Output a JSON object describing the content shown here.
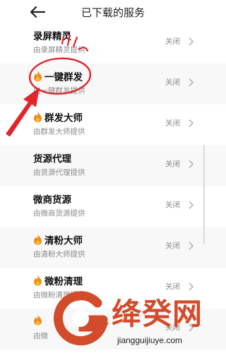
{
  "header": {
    "title": "已下载的服务"
  },
  "services": [
    {
      "name": "录屏精灵",
      "provider": "由录屏精灵提供",
      "status": "关闭",
      "fire": false
    },
    {
      "name": "一键群发",
      "provider": "由一键群发提供",
      "status": "关闭",
      "fire": true
    },
    {
      "name": "群发大师",
      "provider": "由群发大师提供",
      "status": "关闭",
      "fire": true
    },
    {
      "name": "货源代理",
      "provider": "由货源代理提供",
      "status": "关闭",
      "fire": false
    },
    {
      "name": "微商货源",
      "provider": "由微商货源提供",
      "status": "关闭",
      "fire": false
    },
    {
      "name": "清粉大师",
      "provider": "由清粉大师提供",
      "status": "关闭",
      "fire": true
    },
    {
      "name": "微粉清理",
      "provider": "由微粉清理提供",
      "status": "关闭",
      "fire": true
    },
    {
      "name": "",
      "provider": "由微",
      "status": "关闭",
      "fire": true
    }
  ],
  "watermark": {
    "brand": "绛癸网",
    "url": "jiangguijiuye.com"
  },
  "colors": {
    "annotation": "#e0252b",
    "watermark": "#d24b2a"
  }
}
